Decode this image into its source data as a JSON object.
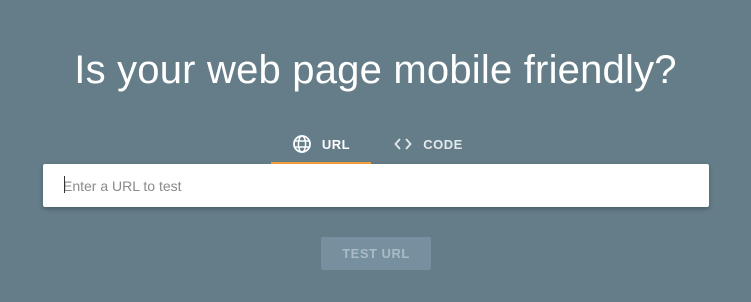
{
  "page": {
    "title": "Is your web page mobile friendly?"
  },
  "tabs": [
    {
      "label": "URL",
      "icon": "globe-icon",
      "active": true
    },
    {
      "label": "CODE",
      "icon": "code-icon",
      "active": false
    }
  ],
  "input": {
    "placeholder": "Enter a URL to test",
    "value": ""
  },
  "button": {
    "label": "TEST URL",
    "disabled": true
  },
  "colors": {
    "background": "#647d88",
    "active_tab_underline": "#f5a13b",
    "button_disabled_bg": "#7790a0"
  }
}
